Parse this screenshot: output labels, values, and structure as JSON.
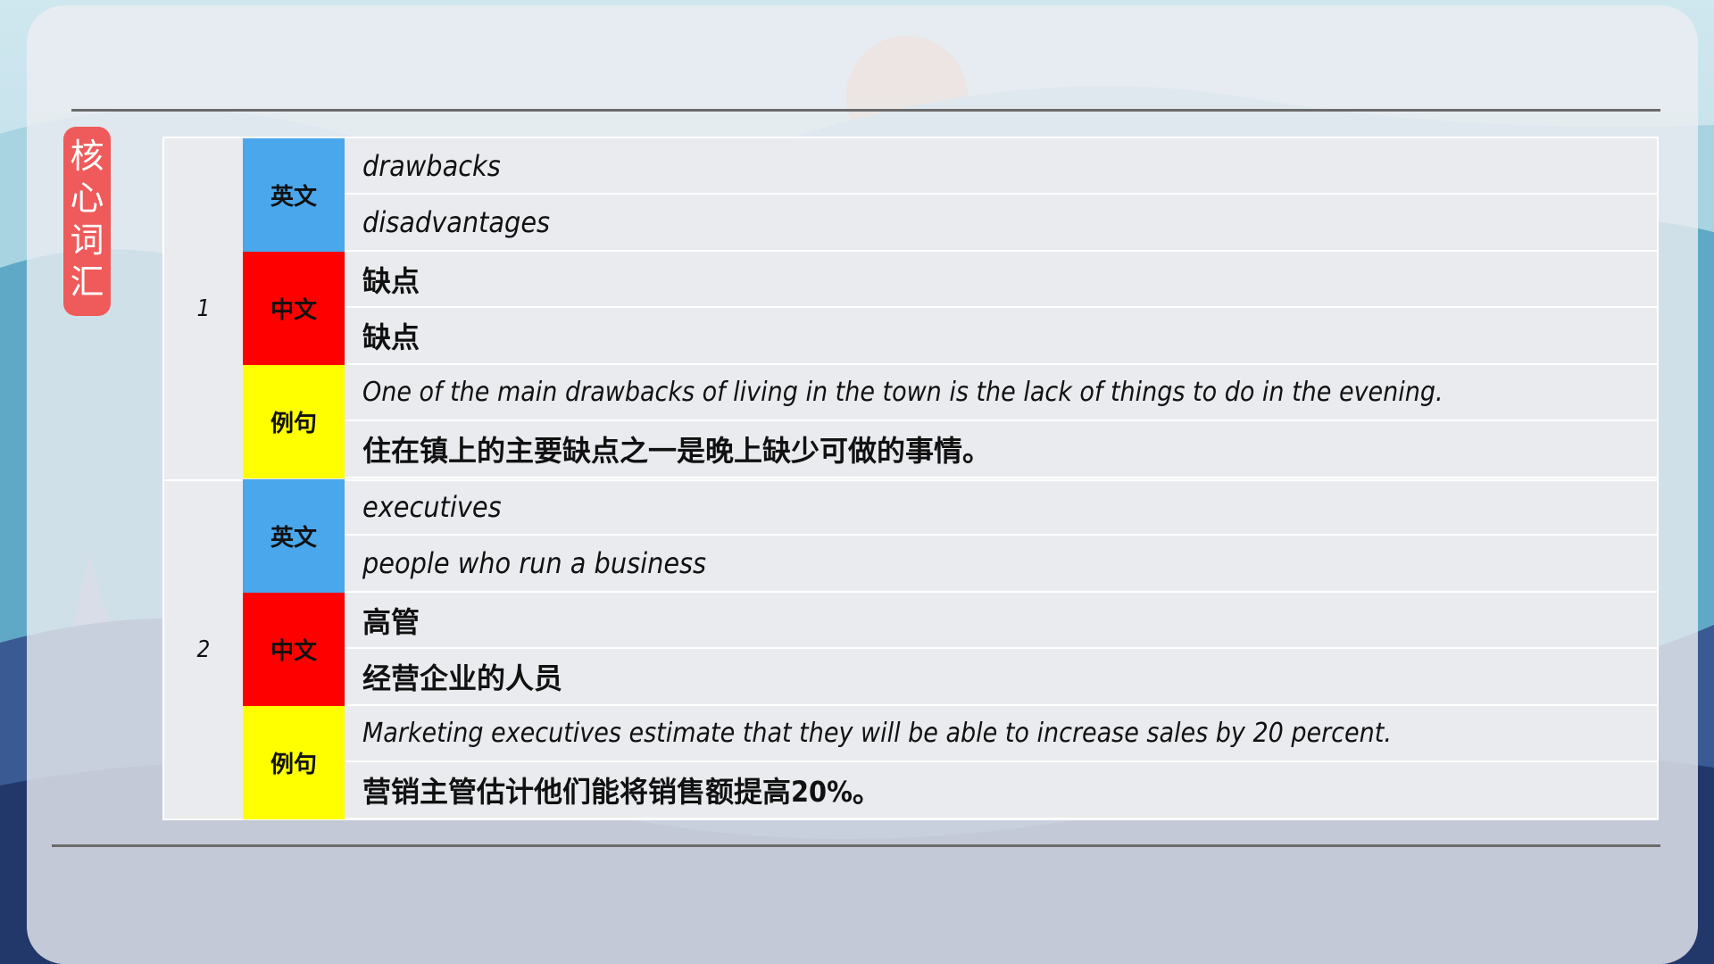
{
  "side_title": [
    "核",
    "心",
    "词",
    "汇"
  ],
  "labels": {
    "english": "英文",
    "chinese": "中文",
    "example": "例句"
  },
  "entries": [
    {
      "number": "1",
      "english": [
        "drawbacks",
        "disadvantages"
      ],
      "chinese": [
        "缺点",
        "缺点"
      ],
      "example": [
        "One of the main drawbacks of living in the town is the lack of things to do in the evening.",
        "住在镇上的主要缺点之一是晚上缺少可做的事情。"
      ]
    },
    {
      "number": "2",
      "english": [
        "executives",
        "people who run a business"
      ],
      "chinese": [
        "高管",
        "经营企业的人员"
      ],
      "example": [
        "Marketing executives estimate that they will be able to increase sales by 20 percent.",
        "营销主管估计他们能将销售额提高20%。"
      ]
    }
  ],
  "colors": {
    "english_label": "#4aa7ec",
    "chinese_label": "#ff0000",
    "example_label": "#ffff00",
    "side_tag": "#ef5a5a"
  }
}
